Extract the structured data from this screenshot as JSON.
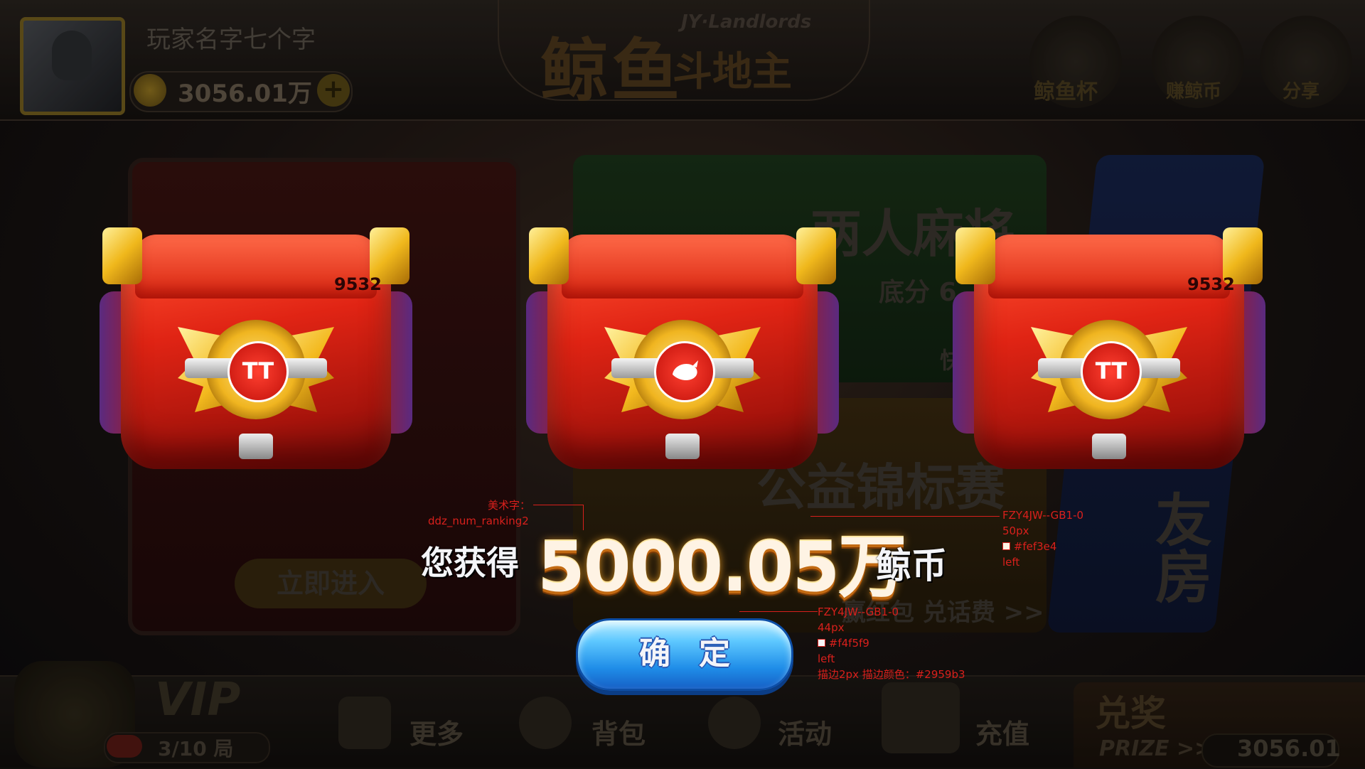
{
  "player": {
    "name": "玩家名字七个字",
    "coins": "3056.01万",
    "plus": "+"
  },
  "logo": {
    "main": "鲸鱼",
    "sub": "斗地主",
    "en": "JY·Landlords"
  },
  "top_icons": [
    {
      "label": "鲸鱼杯",
      "icon": "trophy-icon"
    },
    {
      "label": "赚鲸币",
      "icon": "whale-icon"
    },
    {
      "label": "分享",
      "icon": "wechat-icon"
    }
  ],
  "lobby": {
    "card_green_title": "两人麻将",
    "card_green_sub": "底分 6",
    "card_green_quick": "快",
    "card_orange_title": "公益锦标赛",
    "card_orange_sub": "赢红包 兑话费 >>",
    "card_blue_title": "友房",
    "card_left_btn": "立即进入"
  },
  "bottom": {
    "vip_label": "VIP",
    "vip_progress": "3/10 局",
    "nav": [
      {
        "label": "更多",
        "icon": "grid-icon"
      },
      {
        "label": "背包",
        "icon": "bag-icon"
      },
      {
        "label": "活动",
        "icon": "activity-icon"
      },
      {
        "label": "充值",
        "icon": "cart-icon"
      }
    ],
    "prize_title": "兑奖",
    "prize_en": "PRIZE >>",
    "prize_value": "3056.01"
  },
  "reward": {
    "prefix": "您获得",
    "amount": "5000.05万",
    "unit": "鲸币",
    "chests": [
      {
        "number": "9532",
        "emblem": "TT"
      },
      {
        "number": "",
        "emblem": "whale"
      },
      {
        "number": "9532",
        "emblem": "TT"
      }
    ]
  },
  "confirm_label": "确定",
  "annotations": {
    "art_font_1": "美术字：",
    "art_font_2": "ddz_num_ranking2",
    "amount_font": [
      "FZY4JW--GB1-0",
      "50px",
      "#fef3e4",
      "left"
    ],
    "button_font": [
      "FZY4JW--GB1-0",
      "44px",
      "#f4f5f9",
      "left",
      "描边2px  描边颜色：#2959b3"
    ]
  },
  "colors": {
    "amount": "#fef3e4",
    "button_text": "#f4f5f9",
    "button_stroke": "#2959b3",
    "annotation": "#d8201c"
  }
}
